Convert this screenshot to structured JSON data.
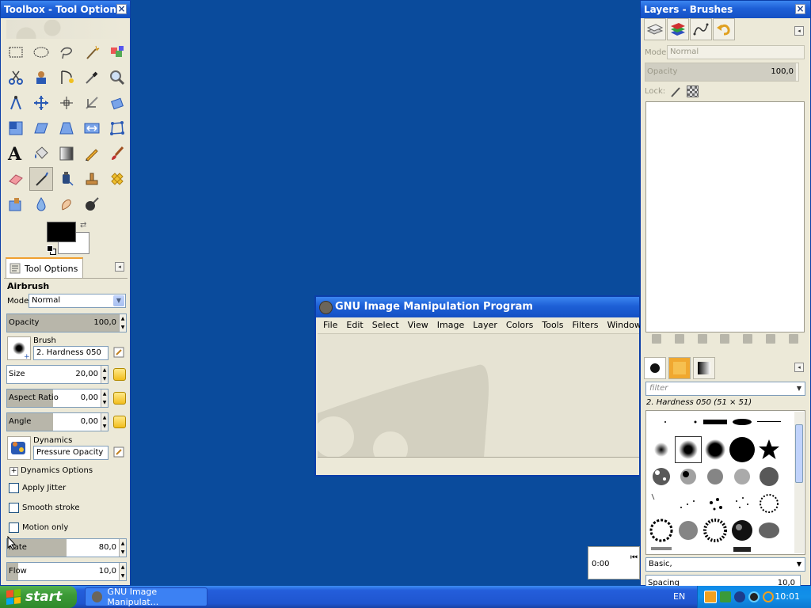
{
  "toolbox": {
    "title": "Toolbox - Tool Options",
    "tab_label": "Tool Options",
    "tool_name": "Airbrush",
    "mode_label": "Mode:",
    "mode_value": "Normal",
    "opacity_label": "Opacity",
    "opacity_value": "100,0",
    "brush_label": "Brush",
    "brush_value": "2. Hardness 050",
    "size_label": "Size",
    "size_value": "20,00",
    "aspect_label": "Aspect Ratio",
    "aspect_value": "0,00",
    "angle_label": "Angle",
    "angle_value": "0,00",
    "dynamics_label": "Dynamics",
    "dynamics_value": "Pressure Opacity",
    "dynamics_options": "Dynamics Options",
    "apply_jitter": "Apply Jitter",
    "smooth_stroke": "Smooth stroke",
    "motion_only": "Motion only",
    "rate_label": "Rate",
    "rate_value": "80,0",
    "flow_label": "Flow",
    "flow_value": "10,0",
    "colors": {
      "fg": "#000000",
      "bg": "#ffffff"
    }
  },
  "gimp": {
    "title": "GNU Image Manipulation Program",
    "menu": [
      "File",
      "Edit",
      "Select",
      "View",
      "Image",
      "Layer",
      "Colors",
      "Tools",
      "Filters",
      "Windows"
    ]
  },
  "layers": {
    "title": "Layers - Brushes",
    "mode_label": "Mode:",
    "mode_value": "Normal",
    "opacity_label": "Opacity",
    "opacity_value": "100,0",
    "lock_label": "Lock:",
    "filter_placeholder": "filter",
    "brush_name": "2. Hardness 050 (51 × 51)",
    "brush_set": "Basic,",
    "spacing_label": "Spacing",
    "spacing_value": "10,0"
  },
  "timer": {
    "value": "0:00"
  },
  "taskbar": {
    "start": "start",
    "task": "GNU Image Manipulat...",
    "lang": "EN",
    "clock": "10:01"
  }
}
